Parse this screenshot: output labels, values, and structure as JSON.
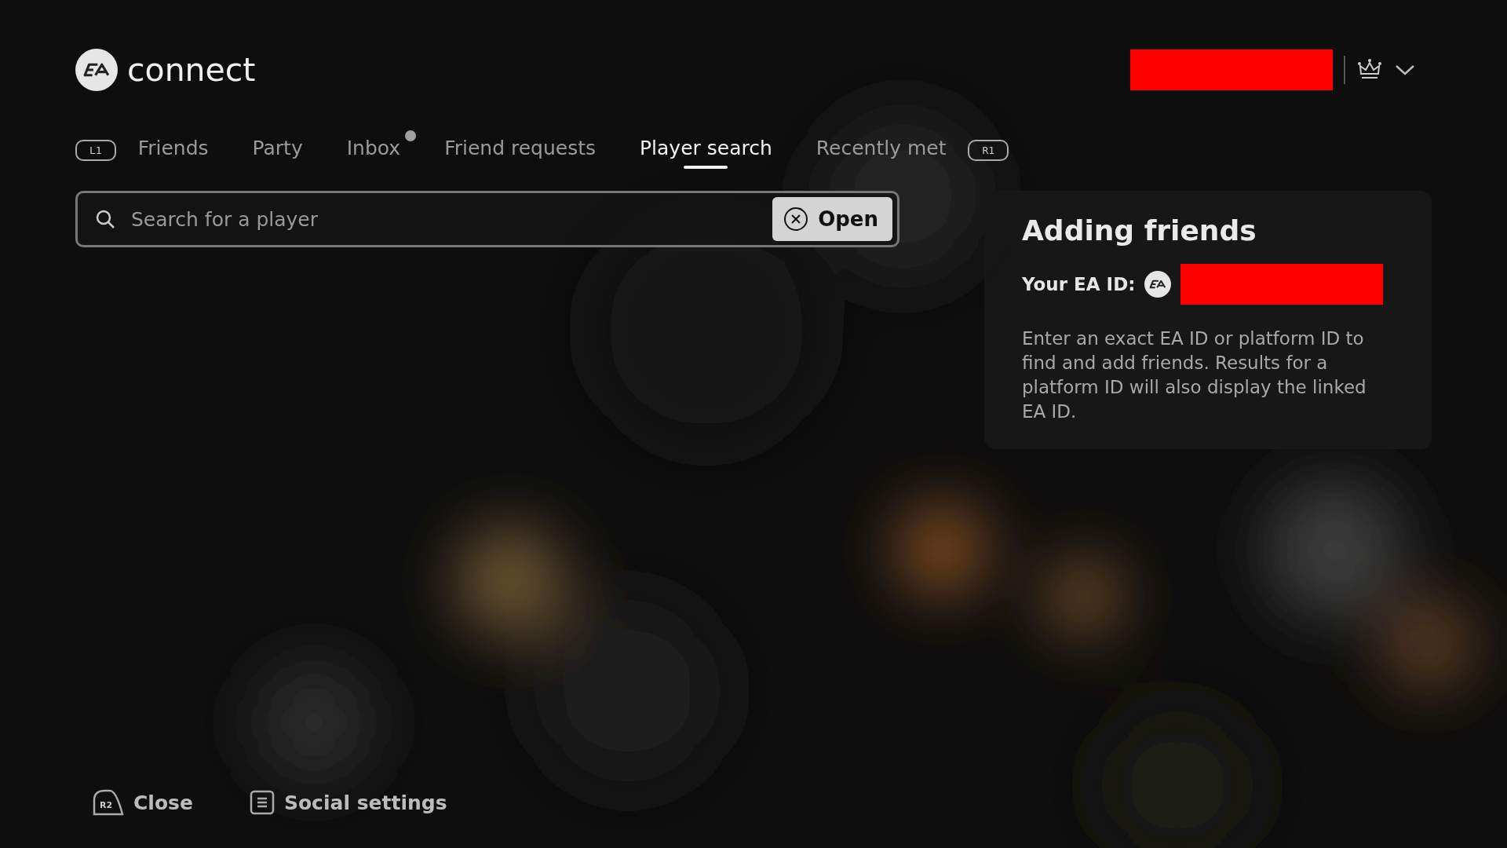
{
  "header": {
    "logo_text": "connect",
    "profile_name": {
      "kind": "redacted"
    }
  },
  "tabs": {
    "prev_key": "L1",
    "next_key": "R1",
    "items": [
      {
        "label": "Friends",
        "selected": false,
        "unread": false
      },
      {
        "label": "Party",
        "selected": false,
        "unread": false
      },
      {
        "label": "Inbox",
        "selected": false,
        "unread": true
      },
      {
        "label": "Friend requests",
        "selected": false,
        "unread": false
      },
      {
        "label": "Player search",
        "selected": true,
        "unread": false
      },
      {
        "label": "Recently met",
        "selected": false,
        "unread": false
      }
    ]
  },
  "search": {
    "placeholder": "Search for a player",
    "button": "Open"
  },
  "info_panel": {
    "title": "Adding friends",
    "ea_id_label": "Your EA ID:",
    "ea_id_value": {
      "kind": "redacted"
    },
    "text": "Enter an exact EA ID or platform ID to find and add friends. Results for a platform ID will also display the linked EA ID."
  },
  "footer": [
    {
      "key": "R2",
      "kind": "trigger",
      "label": "Close"
    },
    {
      "kind": "menu",
      "label": "Social settings"
    }
  ]
}
